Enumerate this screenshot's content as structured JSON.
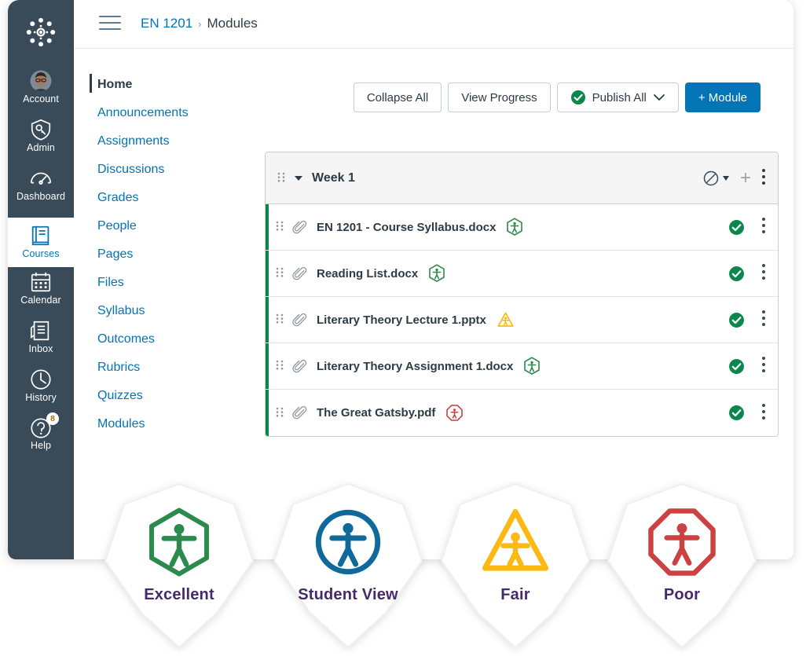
{
  "global_nav": {
    "logo_icon": "canvas-logo-icon",
    "items": [
      {
        "label": "Account",
        "icon": "avatar-icon",
        "active": false
      },
      {
        "label": "Admin",
        "icon": "shield-key-icon",
        "active": false
      },
      {
        "label": "Dashboard",
        "icon": "gauge-icon",
        "active": false
      },
      {
        "label": "Courses",
        "icon": "book-icon",
        "active": true
      },
      {
        "label": "Calendar",
        "icon": "calendar-icon",
        "active": false
      },
      {
        "label": "Inbox",
        "icon": "inbox-tray-icon",
        "active": false
      },
      {
        "label": "History",
        "icon": "clock-icon",
        "active": false
      },
      {
        "label": "Help",
        "icon": "question-mark-icon",
        "active": false,
        "badge": "8"
      }
    ]
  },
  "topbar": {
    "menu_icon": "hamburger-menu-icon",
    "breadcrumb": {
      "course": "EN 1201",
      "separator": "›",
      "current": "Modules"
    }
  },
  "course_nav": {
    "items": [
      {
        "label": "Home",
        "active": true
      },
      {
        "label": "Announcements",
        "active": false
      },
      {
        "label": "Assignments",
        "active": false
      },
      {
        "label": "Discussions",
        "active": false
      },
      {
        "label": "Grades",
        "active": false
      },
      {
        "label": "People",
        "active": false
      },
      {
        "label": "Pages",
        "active": false
      },
      {
        "label": "Files",
        "active": false
      },
      {
        "label": "Syllabus",
        "active": false
      },
      {
        "label": "Outcomes",
        "active": false
      },
      {
        "label": "Rubrics",
        "active": false
      },
      {
        "label": "Quizzes",
        "active": false
      },
      {
        "label": "Modules",
        "active": false
      }
    ]
  },
  "toolbar": {
    "collapse_all": "Collapse All",
    "view_progress": "View Progress",
    "publish_all": "Publish All",
    "publish_all_icon": "published-check-icon",
    "publish_all_caret_icon": "chevron-down-icon",
    "add_module": "+ Module"
  },
  "module": {
    "title": "Week 1",
    "drag_icon": "drag-handle-icon",
    "collapse_icon": "caret-down-icon",
    "publish_state_icon": "unpublished-circle-slash-icon",
    "publish_caret_icon": "caret-down-icon",
    "add_item_icon": "plus-icon",
    "menu_icon": "kebab-menu-icon",
    "items": [
      {
        "name": "EN 1201 - Course Syllabus.docx",
        "type_icon": "paperclip-icon",
        "a11y_icon": "a11y-hexagon-green-icon",
        "a11y_rating": "Excellent",
        "publish_icon": "published-check-icon",
        "menu_icon": "kebab-menu-icon"
      },
      {
        "name": "Reading List.docx",
        "type_icon": "paperclip-icon",
        "a11y_icon": "a11y-hexagon-green-icon",
        "a11y_rating": "Excellent",
        "publish_icon": "published-check-icon",
        "menu_icon": "kebab-menu-icon"
      },
      {
        "name": "Literary Theory Lecture 1.pptx",
        "type_icon": "paperclip-icon",
        "a11y_icon": "a11y-triangle-yellow-icon",
        "a11y_rating": "Fair",
        "publish_icon": "published-check-icon",
        "menu_icon": "kebab-menu-icon"
      },
      {
        "name": "Literary Theory Assignment 1.docx",
        "type_icon": "paperclip-icon",
        "a11y_icon": "a11y-hexagon-green-icon",
        "a11y_rating": "Excellent",
        "publish_icon": "published-check-icon",
        "menu_icon": "kebab-menu-icon"
      },
      {
        "name": "The Great Gatsby.pdf",
        "type_icon": "paperclip-icon",
        "a11y_icon": "a11y-octagon-red-icon",
        "a11y_rating": "Poor",
        "publish_icon": "published-check-icon",
        "menu_icon": "kebab-menu-icon"
      }
    ]
  },
  "legend": {
    "badges": [
      {
        "label": "Excellent",
        "icon": "a11y-hexagon-green-icon",
        "color": "#2B8A4C"
      },
      {
        "label": "Student View",
        "icon": "a11y-circle-blue-icon",
        "color": "#10699B"
      },
      {
        "label": "Fair",
        "icon": "a11y-triangle-yellow-icon",
        "color": "#FDB913"
      },
      {
        "label": "Poor",
        "icon": "a11y-octagon-red-icon",
        "color": "#CC4141"
      }
    ],
    "label_color": "#452A6B"
  },
  "colors": {
    "nav_dark": "#394B58",
    "link_blue": "#0374B5",
    "published_green": "#0B874B",
    "text_dark": "#2D3B45",
    "border_grey": "#C7CDD1"
  }
}
